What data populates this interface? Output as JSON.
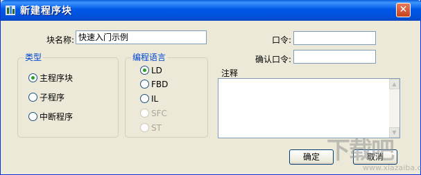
{
  "window": {
    "title": "新建程序块",
    "close_glyph": "✕"
  },
  "form": {
    "block_name_label": "块名称:",
    "block_name_value": "快速入门示例",
    "password_label": "口令:",
    "password_value": "",
    "confirm_label": "确认口令:",
    "confirm_value": "",
    "comment_label": "注释"
  },
  "type_group": {
    "legend": "类型",
    "options": [
      {
        "label": "主程序块",
        "checked": true
      },
      {
        "label": "子程序",
        "checked": false
      },
      {
        "label": "中断程序",
        "checked": false
      }
    ]
  },
  "lang_group": {
    "legend": "编程语言",
    "options": [
      {
        "label": "LD",
        "checked": true,
        "enabled": true
      },
      {
        "label": "FBD",
        "checked": false,
        "enabled": true
      },
      {
        "label": "IL",
        "checked": false,
        "enabled": true
      },
      {
        "label": "SFC",
        "checked": false,
        "enabled": false
      },
      {
        "label": "ST",
        "checked": false,
        "enabled": false
      }
    ]
  },
  "buttons": {
    "ok": "确定",
    "cancel": "取消"
  },
  "watermark": {
    "main": "下载吧",
    "sub": "www.xiazaiba.com"
  },
  "colors": {
    "titlebar": "#0058e6",
    "legend": "#0046d5",
    "dialog_bg": "#ece9d8"
  }
}
